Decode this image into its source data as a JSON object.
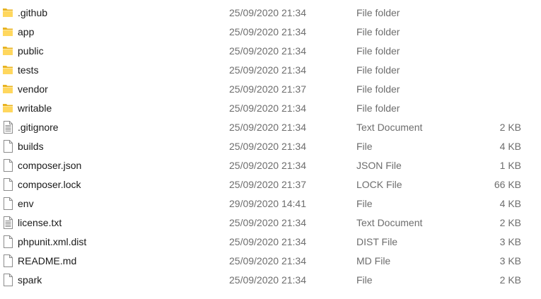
{
  "files": [
    {
      "name": ".github",
      "date": "25/09/2020 21:34",
      "type": "File folder",
      "size": "",
      "icon": "folder-icon"
    },
    {
      "name": "app",
      "date": "25/09/2020 21:34",
      "type": "File folder",
      "size": "",
      "icon": "folder-icon"
    },
    {
      "name": "public",
      "date": "25/09/2020 21:34",
      "type": "File folder",
      "size": "",
      "icon": "folder-icon"
    },
    {
      "name": "tests",
      "date": "25/09/2020 21:34",
      "type": "File folder",
      "size": "",
      "icon": "folder-icon"
    },
    {
      "name": "vendor",
      "date": "25/09/2020 21:37",
      "type": "File folder",
      "size": "",
      "icon": "folder-icon"
    },
    {
      "name": "writable",
      "date": "25/09/2020 21:34",
      "type": "File folder",
      "size": "",
      "icon": "folder-icon"
    },
    {
      "name": ".gitignore",
      "date": "25/09/2020 21:34",
      "type": "Text Document",
      "size": "2 KB",
      "icon": "text-document-icon"
    },
    {
      "name": "builds",
      "date": "25/09/2020 21:34",
      "type": "File",
      "size": "4 KB",
      "icon": "file-icon"
    },
    {
      "name": "composer.json",
      "date": "25/09/2020 21:34",
      "type": "JSON File",
      "size": "1 KB",
      "icon": "file-icon"
    },
    {
      "name": "composer.lock",
      "date": "25/09/2020 21:37",
      "type": "LOCK File",
      "size": "66 KB",
      "icon": "file-icon"
    },
    {
      "name": "env",
      "date": "29/09/2020 14:41",
      "type": "File",
      "size": "4 KB",
      "icon": "file-icon"
    },
    {
      "name": "license.txt",
      "date": "25/09/2020 21:34",
      "type": "Text Document",
      "size": "2 KB",
      "icon": "text-document-icon"
    },
    {
      "name": "phpunit.xml.dist",
      "date": "25/09/2020 21:34",
      "type": "DIST File",
      "size": "3 KB",
      "icon": "file-icon"
    },
    {
      "name": "README.md",
      "date": "25/09/2020 21:34",
      "type": "MD File",
      "size": "3 KB",
      "icon": "file-icon"
    },
    {
      "name": "spark",
      "date": "25/09/2020 21:34",
      "type": "File",
      "size": "2 KB",
      "icon": "file-icon"
    }
  ],
  "colors": {
    "folder_light": "#ffe38f",
    "folder_dark": "#e8b321",
    "file_border": "#8c8c8c",
    "text_secondary": "#6d6d6d"
  }
}
